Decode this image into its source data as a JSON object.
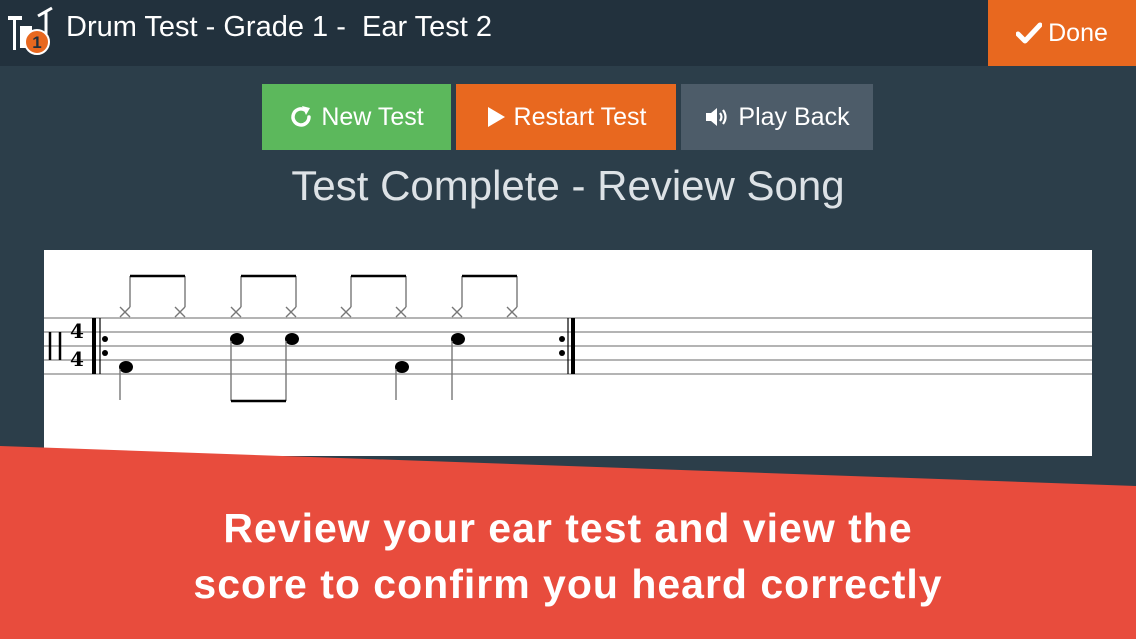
{
  "header": {
    "title": "Drum Test - Grade 1 -  Ear Test 2",
    "logo_icon": "drum-kit-icon",
    "logo_badge": "1",
    "done_label": "Done",
    "done_icon": "check-icon"
  },
  "toolbar": {
    "new_test_label": "New Test",
    "new_test_icon": "refresh-icon",
    "restart_label": "Restart Test",
    "restart_icon": "play-triangle-icon",
    "playback_label": "Play Back",
    "playback_icon": "speaker-icon"
  },
  "status": {
    "title": "Test Complete - Review Song"
  },
  "score": {
    "time_signature_top": "4",
    "time_signature_bottom": "4"
  },
  "promo": {
    "line1": "Review your ear test and view the",
    "line2": "score to confirm you heard correctly"
  },
  "colors": {
    "background": "#2c3e4a",
    "header": "#22313d",
    "accent_orange": "#e8681f",
    "green": "#5cb85c",
    "gray_button": "#4d5c69",
    "banner_red": "#e84c3d"
  }
}
